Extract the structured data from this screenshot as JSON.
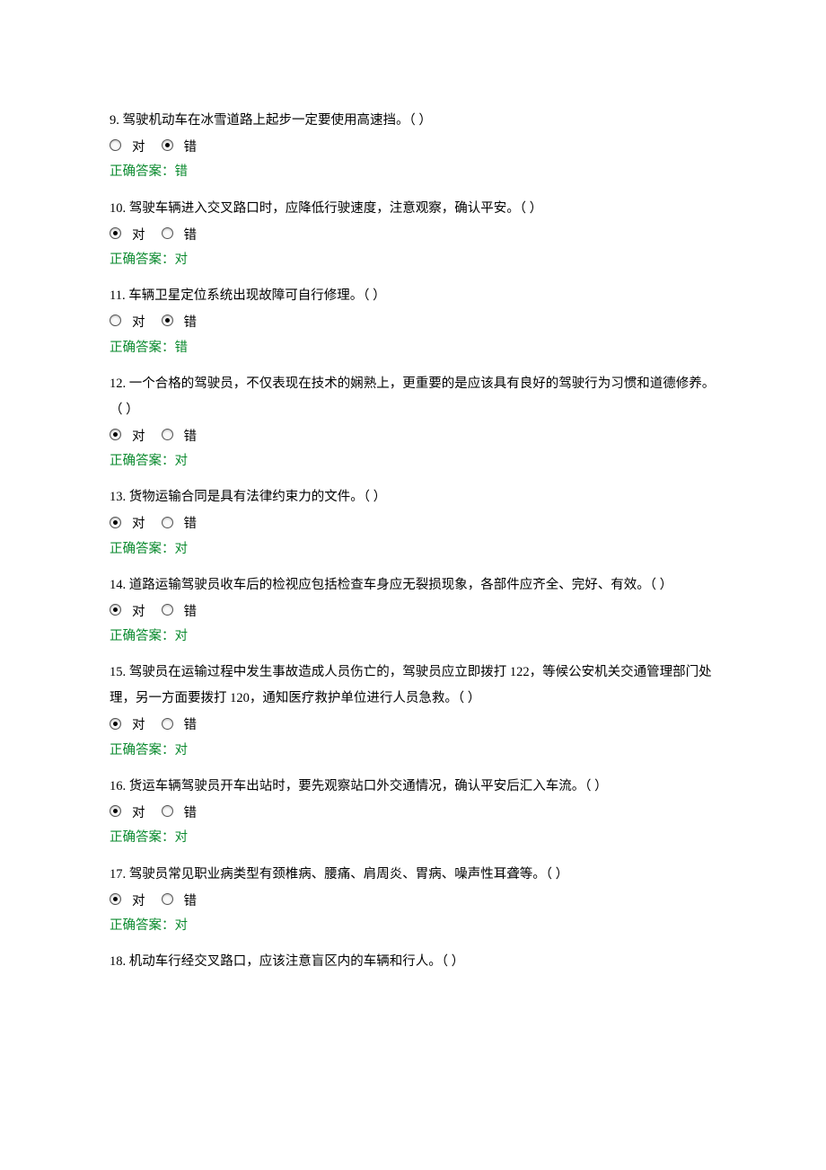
{
  "labels": {
    "true": "对",
    "false": "错",
    "answer_prefix": "正确答案："
  },
  "questions": [
    {
      "number": "9.",
      "text": "驾驶机动车在冰雪道路上起步一定要使用高速挡。（ ）",
      "selected": "false",
      "correct": "错"
    },
    {
      "number": "10.",
      "text": "驾驶车辆进入交叉路口时，应降低行驶速度，注意观察，确认平安。（ ）",
      "selected": "true",
      "correct": "对"
    },
    {
      "number": "11.",
      "text": "车辆卫星定位系统出现故障可自行修理。（ ）",
      "selected": "false",
      "correct": "错"
    },
    {
      "number": "12.",
      "text": "一个合格的驾驶员，不仅表现在技术的娴熟上，更重要的是应该具有良好的驾驶行为习惯和道德修养。（ ）",
      "selected": "true",
      "correct": "对"
    },
    {
      "number": "13.",
      "text": "货物运输合同是具有法律约束力的文件。（ ）",
      "selected": "true",
      "correct": "对"
    },
    {
      "number": "14.",
      "text": "道路运输驾驶员收车后的检视应包括检查车身应无裂损现象，各部件应齐全、完好、有效。（ ）",
      "selected": "true",
      "correct": "对"
    },
    {
      "number": "15.",
      "text": "驾驶员在运输过程中发生事故造成人员伤亡的，驾驶员应立即拨打 122，等候公安机关交通管理部门处理，另一方面要拨打 120，通知医疗救护单位进行人员急救。（ ）",
      "selected": "true",
      "correct": "对"
    },
    {
      "number": "16.",
      "text": "货运车辆驾驶员开车出站时，要先观察站口外交通情况，确认平安后汇入车流。（ ）",
      "selected": "true",
      "correct": "对"
    },
    {
      "number": "17.",
      "text": "驾驶员常见职业病类型有颈椎病、腰痛、肩周炎、胃病、噪声性耳聋等。（ ）",
      "selected": "true",
      "correct": "对"
    },
    {
      "number": "18.",
      "text": "机动车行经交叉路口，应该注意盲区内的车辆和行人。（ ）",
      "selected": null,
      "correct": null
    }
  ]
}
